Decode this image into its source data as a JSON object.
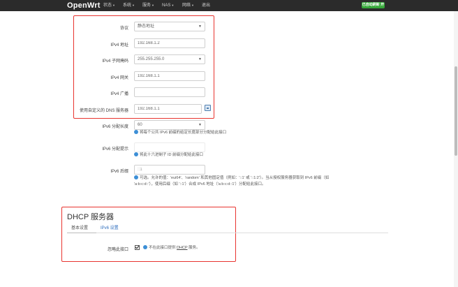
{
  "nav": {
    "brand": "OpenWrt",
    "menus": [
      {
        "label": "状态"
      },
      {
        "label": "系统"
      },
      {
        "label": "服务"
      },
      {
        "label": "NAS"
      },
      {
        "label": "网络"
      },
      {
        "label": "退出"
      }
    ],
    "status_badge": "已自动刷新 开"
  },
  "form": {
    "protocol": {
      "label": "协议",
      "value": "静态地址"
    },
    "ipv4_address": {
      "label": "IPv4 地址",
      "value": "192.168.1.2"
    },
    "ipv4_netmask": {
      "label": "IPv4 子网掩码",
      "value": "255.255.255.0"
    },
    "ipv4_gateway": {
      "label": "IPv4 网关",
      "value": "192.168.1.1"
    },
    "ipv4_broadcast": {
      "label": "IPv4 广播",
      "value": ""
    },
    "custom_dns": {
      "label": "使用自定义的 DNS 服务器",
      "value": "192.168.1.1"
    },
    "ipv6_assign_length": {
      "label": "IPv6 分配长度",
      "value": "60",
      "hint": "将每个公共 IPv6 前缀的给定长度部分分配给此接口"
    },
    "ipv6_assign_hint": {
      "label": "IPv6 分配提示",
      "value": "",
      "hint": "将此十六进制子 ID 前缀分配给此接口"
    },
    "ipv6_suffix": {
      "label": "IPv6 后缀",
      "value": "",
      "placeholder": "::1",
      "hint_line1": "可选。允许的值：'eui64'、'random' 和其他固定值（例如：'::1' 或 '::1:2'）。当从授权服务器获取到 IPv6 前缀（如",
      "hint_line2": "'a:b:c:d::'），使用后缀（如 '::1'）合成 IPv6 地址（'a:b:c:d::1'）分配给此接口。"
    }
  },
  "dhcp": {
    "title": "DHCP 服务器",
    "tabs": [
      {
        "label": "基本设置"
      },
      {
        "label": "IPv6 设置"
      }
    ],
    "ignore": {
      "label": "忽略此接口",
      "checked": true,
      "hint_prefix": "不在此接口提供",
      "hint_link": "DHCP",
      "hint_suffix": "服务。"
    }
  },
  "colors": {
    "annotation_red": "#e8342f",
    "navbar": "#2b2b2b",
    "status_green": "#36a83a",
    "link_blue": "#2d6dbd",
    "info_blue": "#3d8fd6"
  }
}
